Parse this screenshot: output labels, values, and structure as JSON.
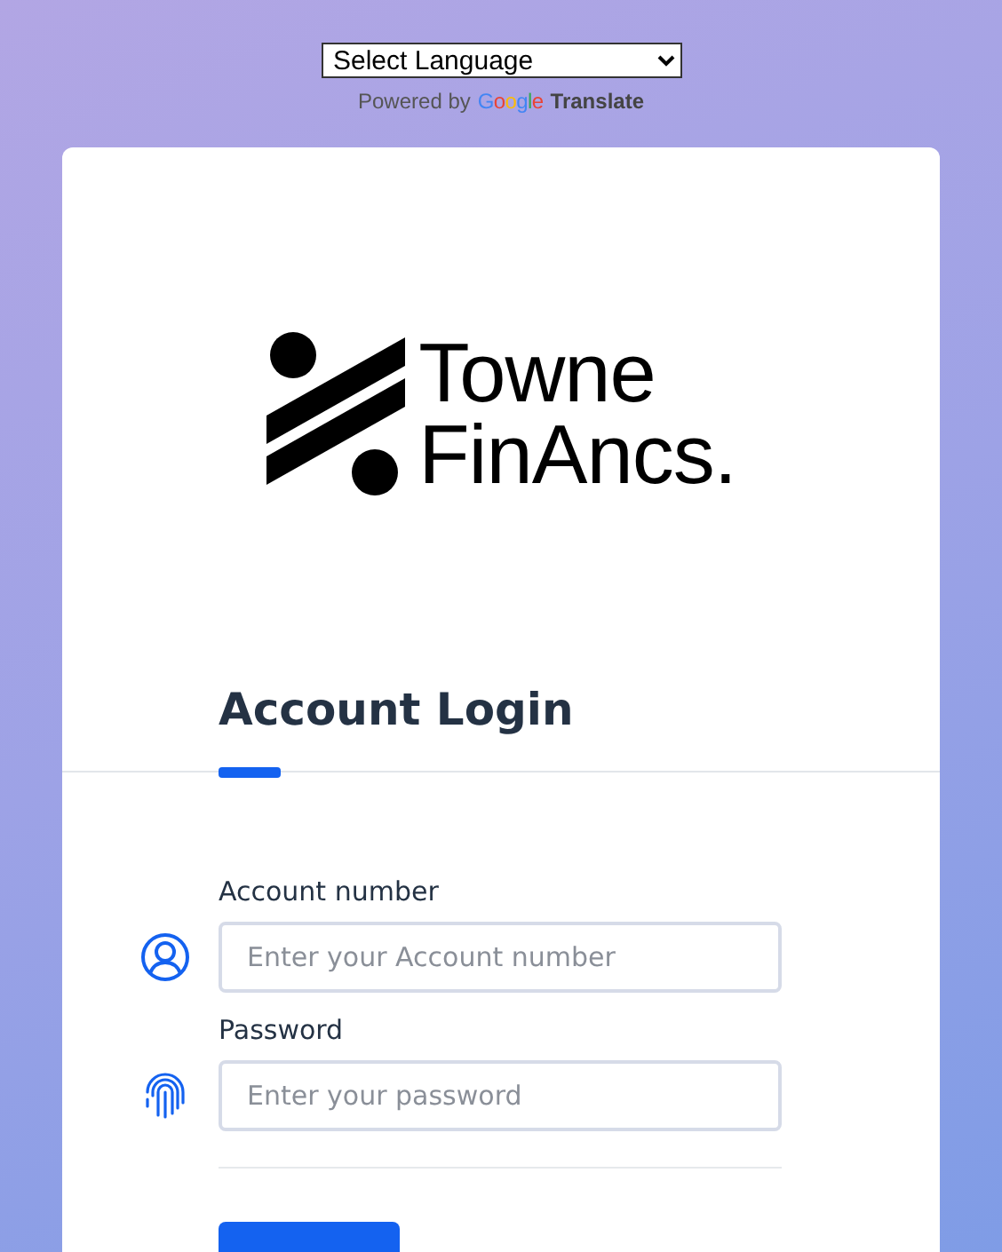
{
  "translate": {
    "select": "Select Language",
    "powered_by": "Powered by",
    "google": "Google",
    "product": "Translate"
  },
  "logo": {
    "line_1": "Towne",
    "line_2": "FinAncs."
  },
  "heading": "Account Login",
  "fields": [
    {
      "label": "Account number",
      "placeholder": "Enter your Account number",
      "kind": "user"
    },
    {
      "label": "Password",
      "placeholder": "Enter your password",
      "kind": "fingerprint"
    }
  ],
  "actions": [
    {
      "kind": "primary"
    }
  ]
}
